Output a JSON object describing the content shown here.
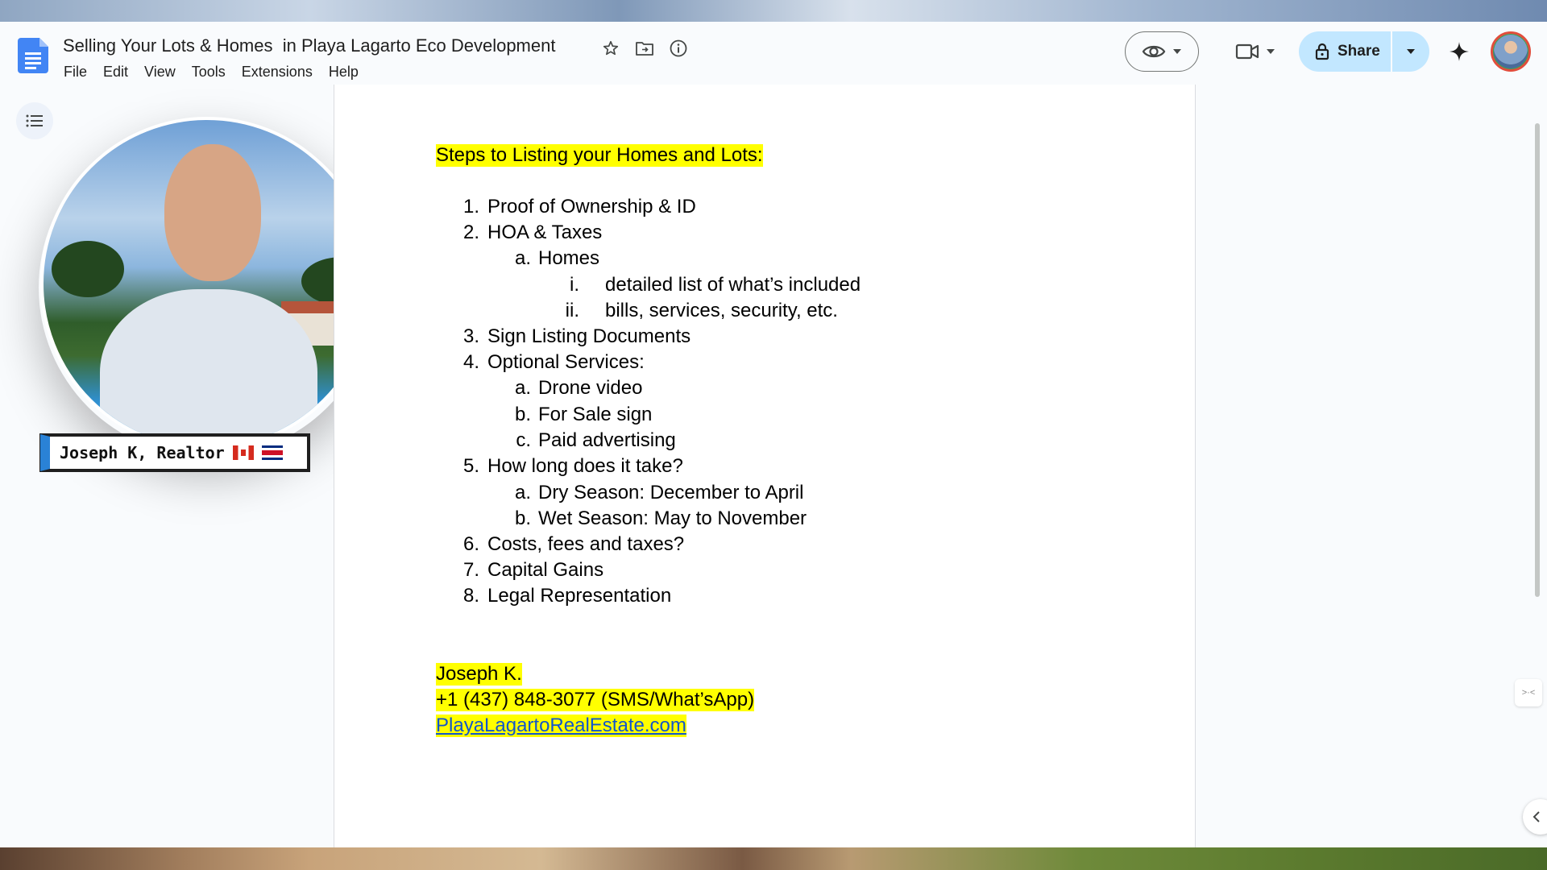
{
  "document": {
    "title": "Selling Your Lots & Homes  in Playa Lagarto Eco Development"
  },
  "menu": [
    "File",
    "Edit",
    "View",
    "Tools",
    "Extensions",
    "Help"
  ],
  "toolbar": {
    "share_label": "Share"
  },
  "presenter": {
    "name_tag": "Joseph K, Realtor"
  },
  "content": {
    "heading": "Steps to Listing your Homes and Lots:",
    "items": [
      {
        "marker": "1.",
        "text": "Proof of Ownership & ID"
      },
      {
        "marker": "2.",
        "text": "HOA & Taxes"
      },
      {
        "marker": "a.",
        "text": "Homes"
      },
      {
        "marker": "i.",
        "text": "detailed list of what’s included"
      },
      {
        "marker": "ii.",
        "text": "bills, services, security, etc."
      },
      {
        "marker": "3.",
        "text": "Sign Listing Documents"
      },
      {
        "marker": "4.",
        "text": "Optional Services:"
      },
      {
        "marker": "a.",
        "text": "Drone video"
      },
      {
        "marker": "b.",
        "text": "For Sale sign"
      },
      {
        "marker": "c.",
        "text": "Paid advertising"
      },
      {
        "marker": "5.",
        "text": "How long does it take?"
      },
      {
        "marker": "a.",
        "text": "Dry Season: December to April"
      },
      {
        "marker": "b.",
        "text": "Wet Season: May to November"
      },
      {
        "marker": "6.",
        "text": "Costs, fees and taxes?"
      },
      {
        "marker": "7.",
        "text": "Capital Gains"
      },
      {
        "marker": "8.",
        "text": "Legal Representation"
      }
    ],
    "contact": {
      "name": "Joseph K.",
      "phone": "+1 (437) 848-3077 (SMS/What’sApp)",
      "website": "PlayaLagartoRealEstate.com"
    }
  },
  "colors": {
    "highlight": "#ffff00",
    "share_bg": "#c2e7ff",
    "docs_blue": "#4285f4",
    "link": "#1155cc"
  }
}
